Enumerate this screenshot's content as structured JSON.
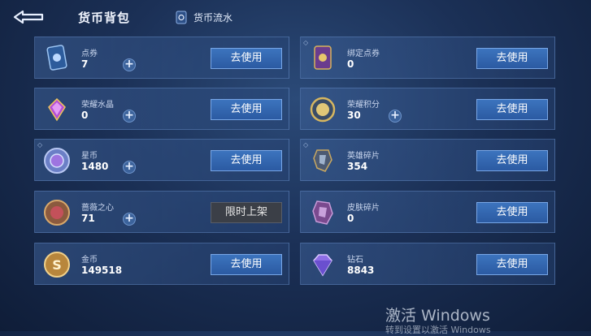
{
  "header": {
    "title": "货币背包",
    "flow_link": "货币流水"
  },
  "currencies": [
    {
      "name": "点券",
      "count": "7",
      "action": "去使用",
      "has_plus": true
    },
    {
      "name": "绑定点券",
      "count": "0",
      "action": "去使用",
      "has_plus": false
    },
    {
      "name": "荣耀水晶",
      "count": "0",
      "action": "去使用",
      "has_plus": true
    },
    {
      "name": "荣耀积分",
      "count": "30",
      "action": "去使用",
      "has_plus": true
    },
    {
      "name": "星币",
      "count": "1480",
      "action": "去使用",
      "has_plus": true
    },
    {
      "name": "英雄碎片",
      "count": "354",
      "action": "去使用",
      "has_plus": false
    },
    {
      "name": "蔷薇之心",
      "count": "71",
      "action": "限时上架",
      "has_plus": true
    },
    {
      "name": "皮肤碎片",
      "count": "0",
      "action": "去使用",
      "has_plus": false
    },
    {
      "name": "金币",
      "count": "149518",
      "action": "去使用",
      "has_plus": false
    },
    {
      "name": "钻石",
      "count": "8843",
      "action": "去使用",
      "has_plus": false
    }
  ],
  "plus_symbol": "+",
  "watermark": {
    "line1": "激活 Windows",
    "line2": "转到设置以激活 Windows"
  },
  "colors": {
    "button": "#3c74be",
    "disabled": "#3b3f47",
    "bg": "#1b3056"
  }
}
